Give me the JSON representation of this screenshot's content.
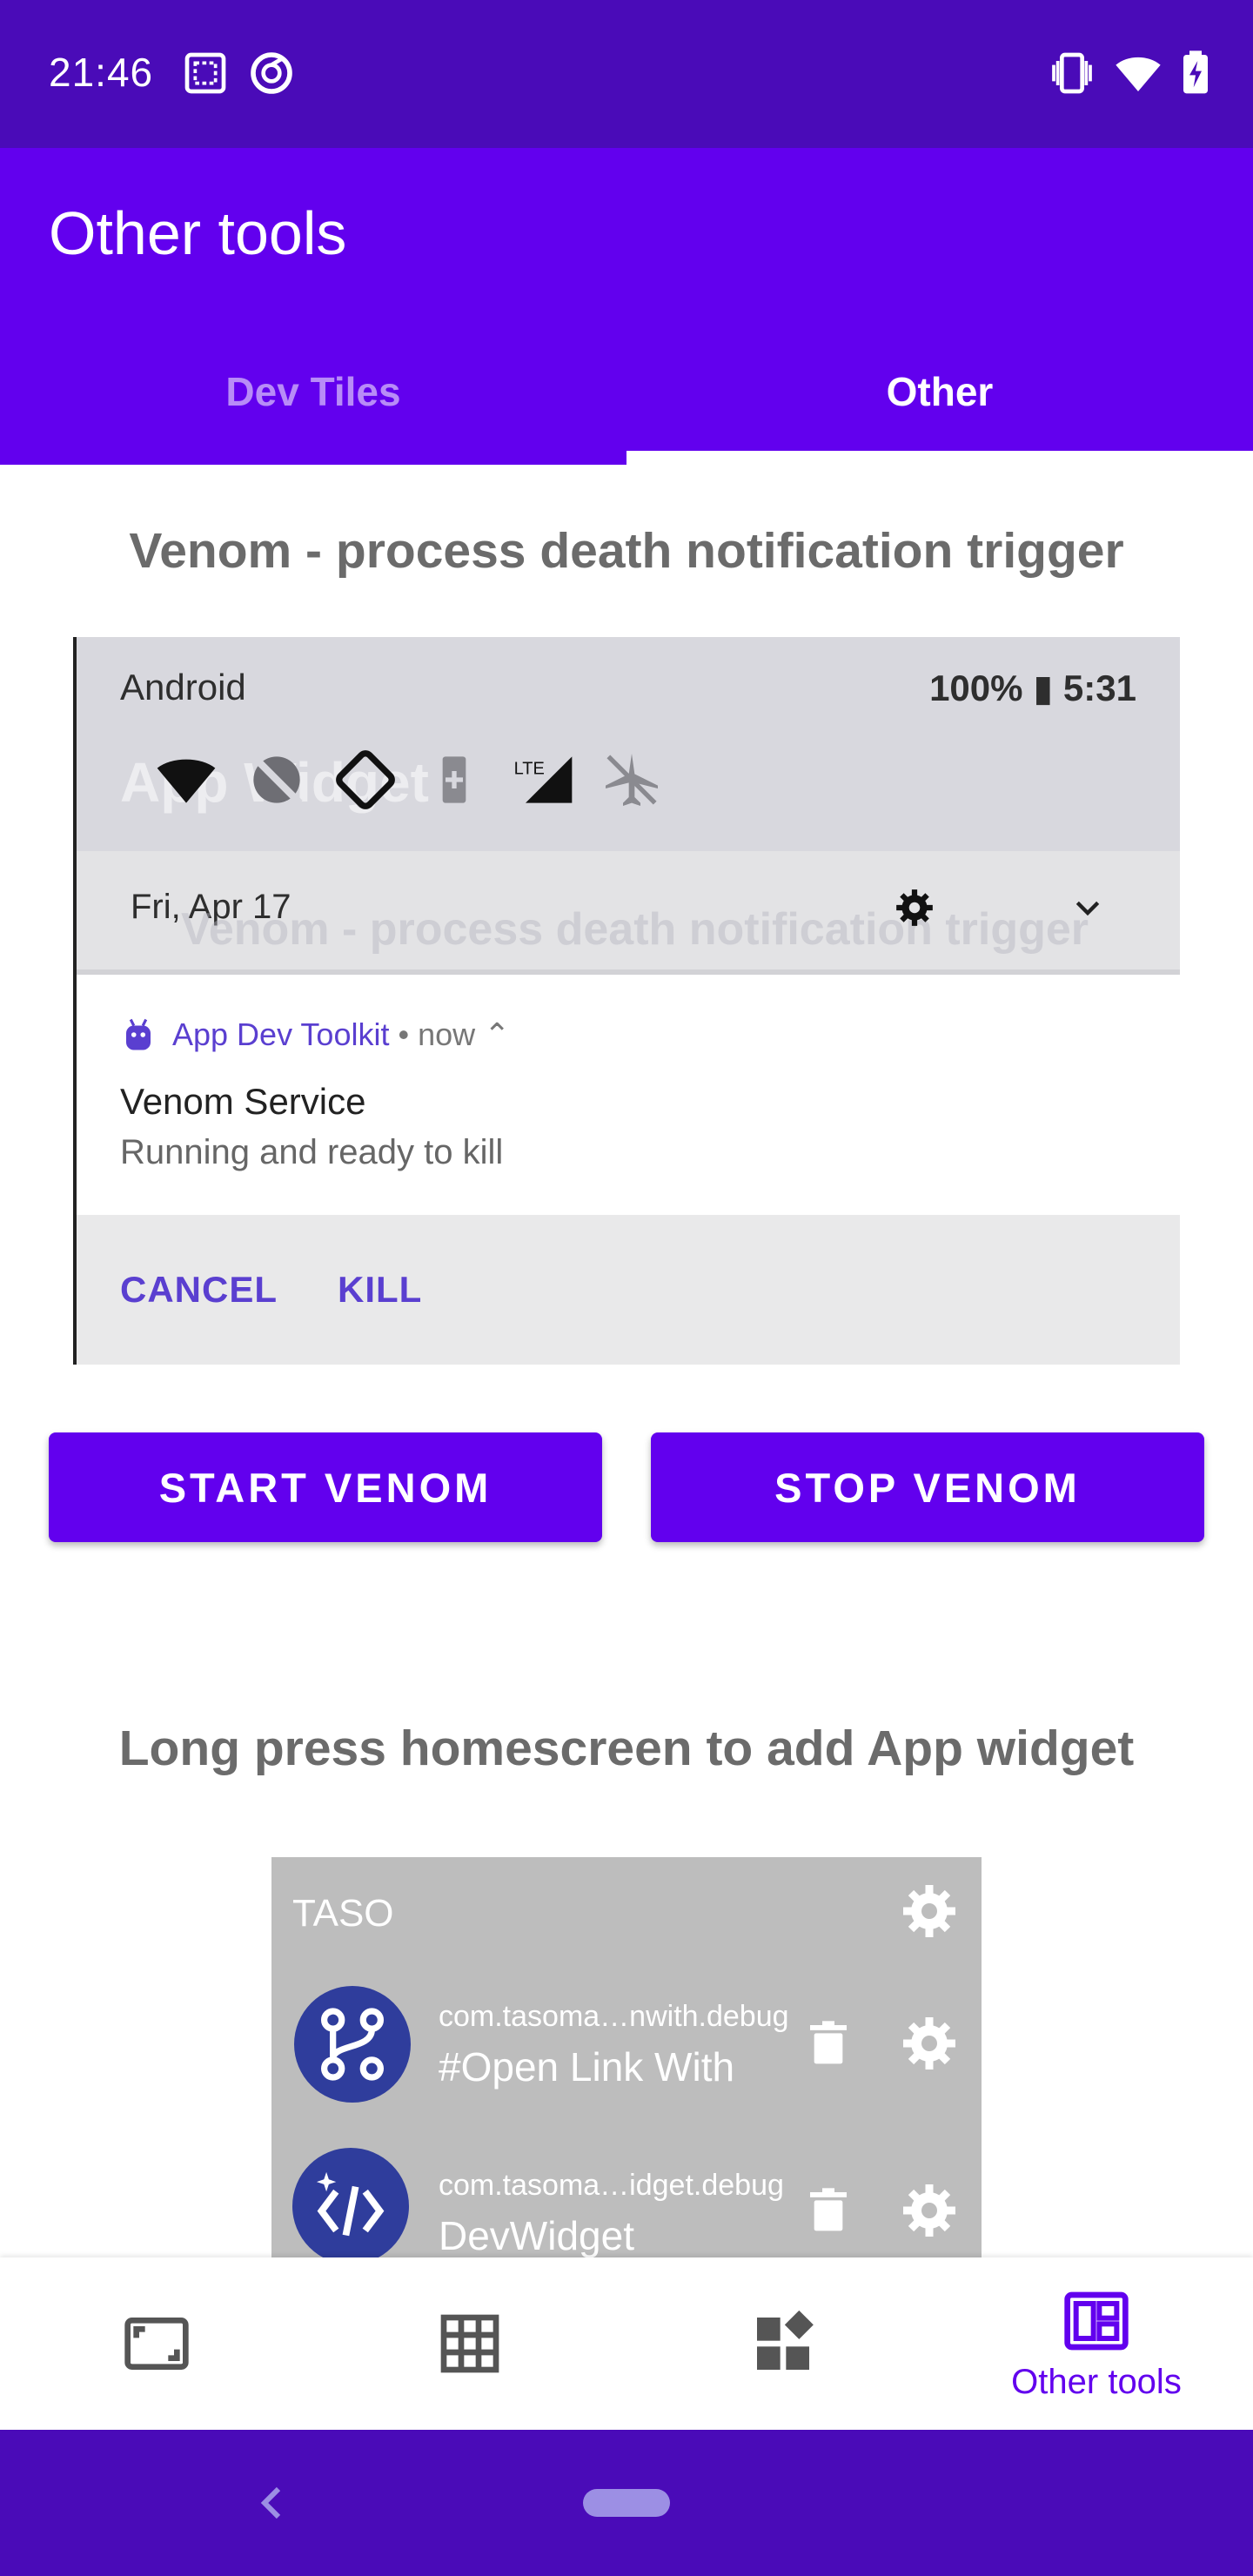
{
  "status_bar": {
    "time": "21:46",
    "left_icons": [
      "screenshot-icon",
      "do-not-disturb-icon"
    ],
    "right_icons": [
      "vibrate-icon",
      "wifi-icon",
      "battery-charging-icon"
    ]
  },
  "app_bar": {
    "title": "Other tools"
  },
  "tabs": [
    {
      "label": "Dev Tiles",
      "selected": false
    },
    {
      "label": "Other",
      "selected": true
    }
  ],
  "venom": {
    "heading": "Venom - process death notification trigger",
    "preview": {
      "carrier": "Android",
      "battery_time": "100% ▮ 5:31",
      "date": "Fri, Apr 17",
      "app_name": "App Dev Toolkit",
      "app_time": "• now ⌃",
      "notif_title": "Venom Service",
      "notif_text": "Running and ready to kill",
      "action_cancel": "CANCEL",
      "action_kill": "KILL",
      "ghost_text_1": "App Widget",
      "ghost_text_2": "Venom - process death notification trigger"
    },
    "start_button": "START VENOM",
    "stop_button": "STOP VENOM"
  },
  "widget_section": {
    "heading": "Long press homescreen to add App widget",
    "widget": {
      "title": "TASO",
      "items": [
        {
          "package": "com.tasoma…nwith.debug",
          "name": "#Open Link With",
          "icon": "branch-icon"
        },
        {
          "package": "com.tasoma…idget.debug",
          "name": "DevWidget",
          "icon": "code-icon"
        }
      ]
    }
  },
  "bottom_nav": {
    "items": [
      {
        "icon": "screen-frame-icon",
        "label": ""
      },
      {
        "icon": "grid-icon",
        "label": ""
      },
      {
        "icon": "widgets-icon",
        "label": ""
      },
      {
        "icon": "dashboard-icon",
        "label": "Other tools",
        "selected": true
      }
    ]
  },
  "colors": {
    "primary": "#6200ee",
    "status_bar": "#4a0bb8",
    "heading_text": "#6b6b6b"
  }
}
